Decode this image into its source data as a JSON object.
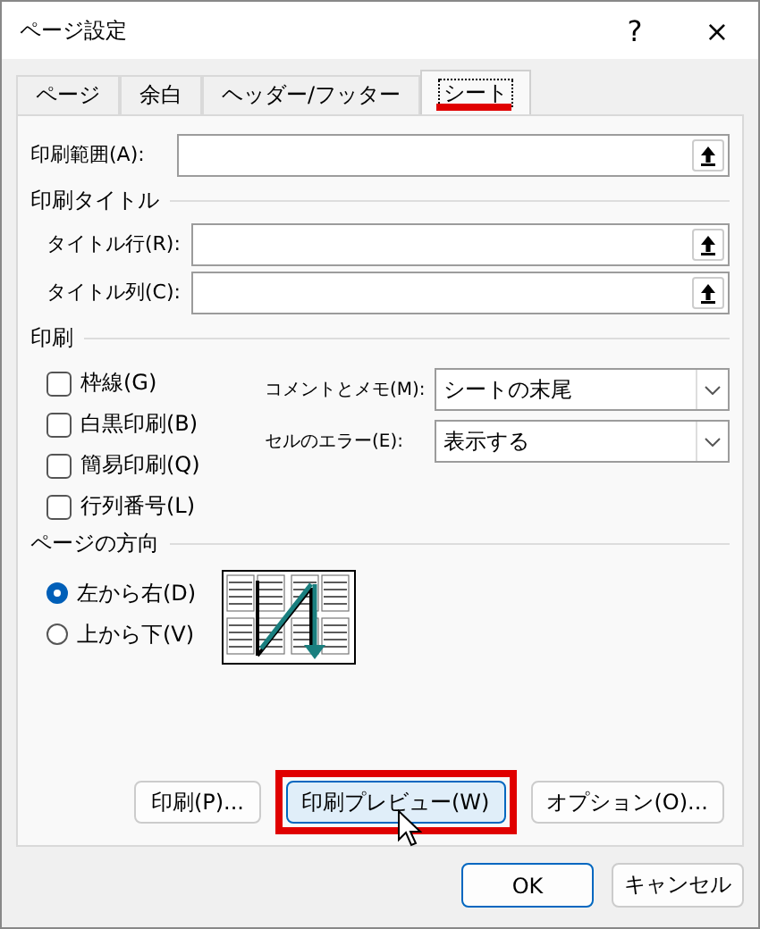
{
  "window": {
    "title": "ページ設定",
    "help": "?",
    "close": "×"
  },
  "tabs": [
    {
      "label": "ページ",
      "selected": false,
      "highlighted": false
    },
    {
      "label": "余白",
      "selected": false,
      "highlighted": false
    },
    {
      "label": "ヘッダー/フッター",
      "selected": false,
      "highlighted": false
    },
    {
      "label": "シート",
      "selected": true,
      "highlighted": true
    }
  ],
  "print_area": {
    "label": "印刷範囲(A):"
  },
  "print_titles": {
    "heading": "印刷タイトル",
    "fields": [
      {
        "label": "タイトル行(R):"
      },
      {
        "label": "タイトル列(C):"
      }
    ]
  },
  "print": {
    "heading": "印刷",
    "checkboxes": [
      {
        "label": "枠線(G)",
        "checked": false
      },
      {
        "label": "白黒印刷(B)",
        "checked": false
      },
      {
        "label": "簡易印刷(Q)",
        "checked": false
      },
      {
        "label": "行列番号(L)",
        "checked": false
      }
    ],
    "dropdowns": [
      {
        "label": "コメントとメモ(M):",
        "value": "シートの末尾"
      },
      {
        "label": "セルのエラー(E):",
        "value": "表示する"
      }
    ]
  },
  "page_order": {
    "heading": "ページの方向",
    "options": [
      {
        "label": "左から右(D)",
        "selected": true
      },
      {
        "label": "上から下(V)",
        "selected": false
      }
    ]
  },
  "panel_buttons": [
    {
      "label": "印刷(P)...",
      "highlighted": false,
      "hovered": false
    },
    {
      "label": "印刷プレビュー(W)",
      "highlighted": true,
      "hovered": true
    },
    {
      "label": "オプション(O)...",
      "highlighted": false,
      "hovered": false
    }
  ],
  "buttons": [
    {
      "label": "OK",
      "default": true
    },
    {
      "label": "キャンセル",
      "default": false
    }
  ]
}
